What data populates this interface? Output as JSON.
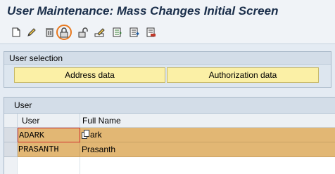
{
  "screen": {
    "title": "User Maintenance: Mass Changes Initial Screen"
  },
  "toolbar": {
    "items": [
      {
        "icon": "new-document-icon"
      },
      {
        "icon": "pencil-icon"
      },
      {
        "icon": "trash-icon"
      },
      {
        "icon": "lock-icon",
        "highlighted": true
      },
      {
        "icon": "unlock-icon"
      },
      {
        "icon": "edit-list-icon"
      },
      {
        "icon": "list-select-icon"
      },
      {
        "icon": "list-export-icon"
      },
      {
        "icon": "list-delete-icon"
      }
    ],
    "highlight_color": "#e8781e"
  },
  "user_selection": {
    "title": "User selection",
    "address_button": "Address data",
    "authorization_button": "Authorization data"
  },
  "user_table": {
    "title": "User",
    "columns": [
      "User",
      "Full Name"
    ],
    "rows": [
      {
        "user": "ADARK",
        "full_name": "ark"
      },
      {
        "user": "PRASANTH",
        "full_name": "Prasanth"
      }
    ]
  },
  "colors": {
    "selected_row": "#e2b774",
    "button_yellow": "#fbf0a6",
    "background": "#e4ebf3"
  }
}
